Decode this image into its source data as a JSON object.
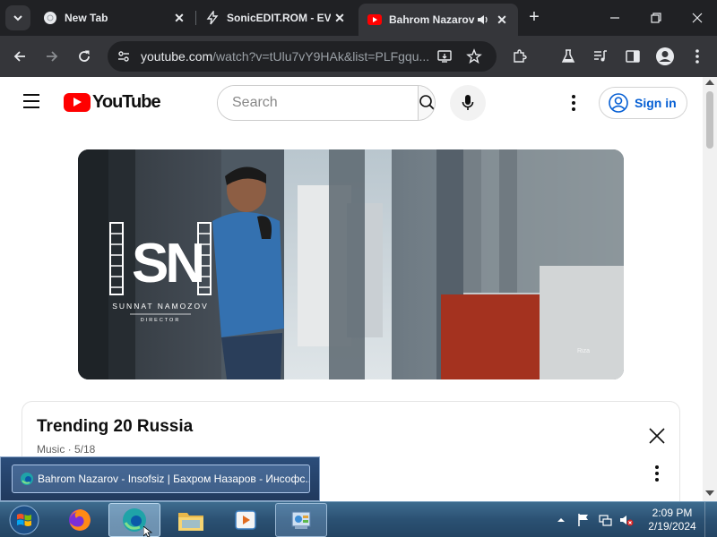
{
  "browser": {
    "tabs": [
      {
        "title": "New Tab",
        "icon": "chrome-icon"
      },
      {
        "title": "SonicEDIT.ROM - EV",
        "icon": "bolt-icon"
      },
      {
        "title": "Bahrom Nazarov",
        "icon": "youtube-icon",
        "active": true,
        "audio": true
      }
    ],
    "url": {
      "host": "youtube.com",
      "path": "/watch?v=tUlu7vY9HAk&list=PLFgqu..."
    }
  },
  "youtube": {
    "logo_text": "YouTube",
    "search_placeholder": "Search",
    "signin_label": "Sign in"
  },
  "video": {
    "logo_text": "SN",
    "logo_name": "SUNNAT NAMOZOV",
    "logo_role": "DIRECTOR",
    "watermark": "Riza"
  },
  "playlist": {
    "title": "Trending 20 Russia",
    "meta": "Music · 5/18"
  },
  "taskbar": {
    "preview_title": "Bahrom Nazarov - Insofsiz | Бахром Назаров - Инсофс...",
    "clock_time": "2:09 PM",
    "clock_date": "2/19/2024"
  },
  "colors": {
    "chrome_dark": "#202124",
    "chrome_toolbar": "#35363a",
    "youtube_red": "#ff0000",
    "link_blue": "#065fd4"
  }
}
